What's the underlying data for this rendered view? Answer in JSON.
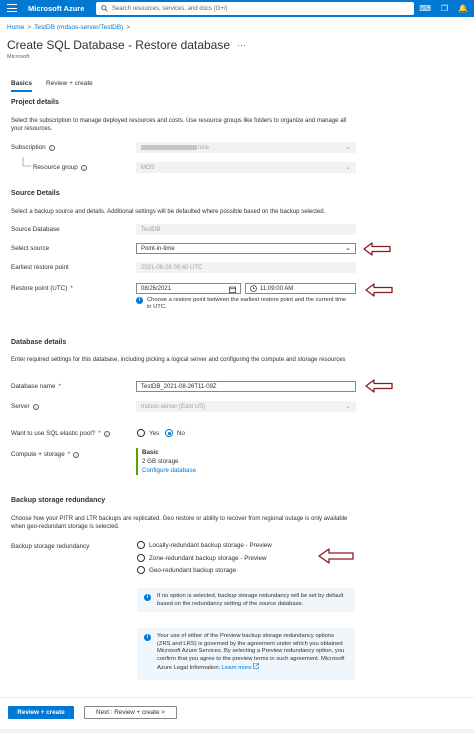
{
  "topbar": {
    "brand": "Microsoft Azure",
    "search_placeholder": "Search resources, services, and docs (G+/)",
    "icons": [
      "cloud-shell-icon",
      "portal-settings-icon",
      "notifications-icon"
    ]
  },
  "breadcrumb": {
    "items": [
      "Home",
      "TestDB (mdsos-server/TestDB)"
    ]
  },
  "page": {
    "title": "Create SQL Database - Restore database",
    "more": "···",
    "subtitle": "Microsoft"
  },
  "tabs": [
    {
      "label": "Basics",
      "active": true
    },
    {
      "label": "Review + create",
      "active": false
    }
  ],
  "project": {
    "heading": "Project details",
    "description": "Select the subscription to manage deployed resources and costs. Use resource groups like folders to organize and manage all your resources.",
    "subscription_label": "Subscription",
    "subscription_value": "nice",
    "resource_group_label": "Resource group",
    "resource_group_value": "MOS"
  },
  "source": {
    "heading": "Source Details",
    "description": "Select a backup source and details. Additional settings will be defaulted where possible based on the backup selected.",
    "source_db_label": "Source Database",
    "source_db_value": "TestDB",
    "select_source_label": "Select source",
    "select_source_value": "Point-in-time",
    "earliest_label": "Earliest restore point",
    "earliest_value": "2021-08-26 08:40 UTC",
    "restore_point_label": "Restore point (UTC)",
    "restore_date": "08/26/2021",
    "restore_time": "11:09:00 AM",
    "restore_note": "Choose a restore point between the earliest restore point and the current time in UTC."
  },
  "database": {
    "heading": "Database details",
    "description": "Enter required settings for this database, including picking a logical server and configuring the compute and storage resources",
    "name_label": "Database name",
    "name_value": "TestDB_2021-08-26T11-09Z",
    "server_label": "Server",
    "server_value": "mdsos-server (East US)",
    "elastic_label": "Want to use SQL elastic pool?",
    "elastic_yes": "Yes",
    "elastic_no": "No",
    "elastic_selected": "No",
    "compute_label": "Compute + storage",
    "compute_tier": "Basic",
    "compute_storage": "2 GB storage",
    "compute_link": "Configure database"
  },
  "redundancy": {
    "heading": "Backup storage redundancy",
    "description": "Choose how your PITR and LTR backups are replicated. Geo restore or ability to recover from regional outage is only available when geo-redundant storage is selected.",
    "label": "Backup storage redundancy",
    "options": [
      "Locally-redundant backup storage - Preview",
      "Zone-redundant backup storage - Preview",
      "Geo-redundant backup storage"
    ],
    "info1": "If no option is selected, backup storage redundancy will be set by default based on the redundancy setting of the source database.",
    "info2": "Your use of either of the Preview backup storage redundancy options (ZRS and LRS) is governed by the agreement under which you obtained Microsoft Azure Services. By selecting a Preview redundancy option, you confirm that you agree to the preview terms in such agreement. Microsoft Azure Legal Information:",
    "info2_link": "Learn more"
  },
  "footer": {
    "primary": "Review + create",
    "secondary": "Next : Review + create >"
  },
  "colors": {
    "accent": "#0078d4",
    "annotation_arrow": "#8b1a1a",
    "compute_bar": "#57a300"
  }
}
